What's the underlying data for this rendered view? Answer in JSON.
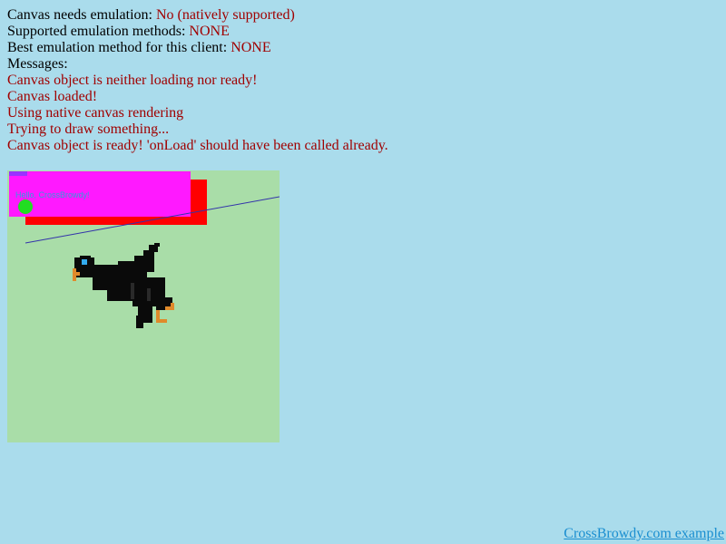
{
  "status": {
    "needs_emulation_label": "Canvas needs emulation:",
    "needs_emulation_value": "No (natively supported)",
    "supported_methods_label": "Supported emulation methods:",
    "supported_methods_value": "NONE",
    "best_method_label": "Best emulation method for this client:",
    "best_method_value": "NONE",
    "messages_label": "Messages:"
  },
  "messages": [
    "Canvas object is neither loading nor ready!",
    "Canvas loaded!",
    "Using native canvas rendering",
    "Trying to draw something...",
    "Canvas object is ready! 'onLoad' should have been called already."
  ],
  "canvas": {
    "text": "Hello, CrossBrowdy!",
    "colors": {
      "background": "#a9dda8",
      "red_rect": "#ff0000",
      "magenta_rect": "#ff19ff",
      "purple_mark": "#9933ff",
      "green_circle": "#22dd22",
      "line": "#3333aa",
      "text": "#3399dd",
      "bird_body": "#0a0a0a",
      "bird_beak": "#e08a2a",
      "bird_eye": "#33aaee"
    }
  },
  "footer": {
    "link_text": "CrossBrowdy.com example"
  }
}
